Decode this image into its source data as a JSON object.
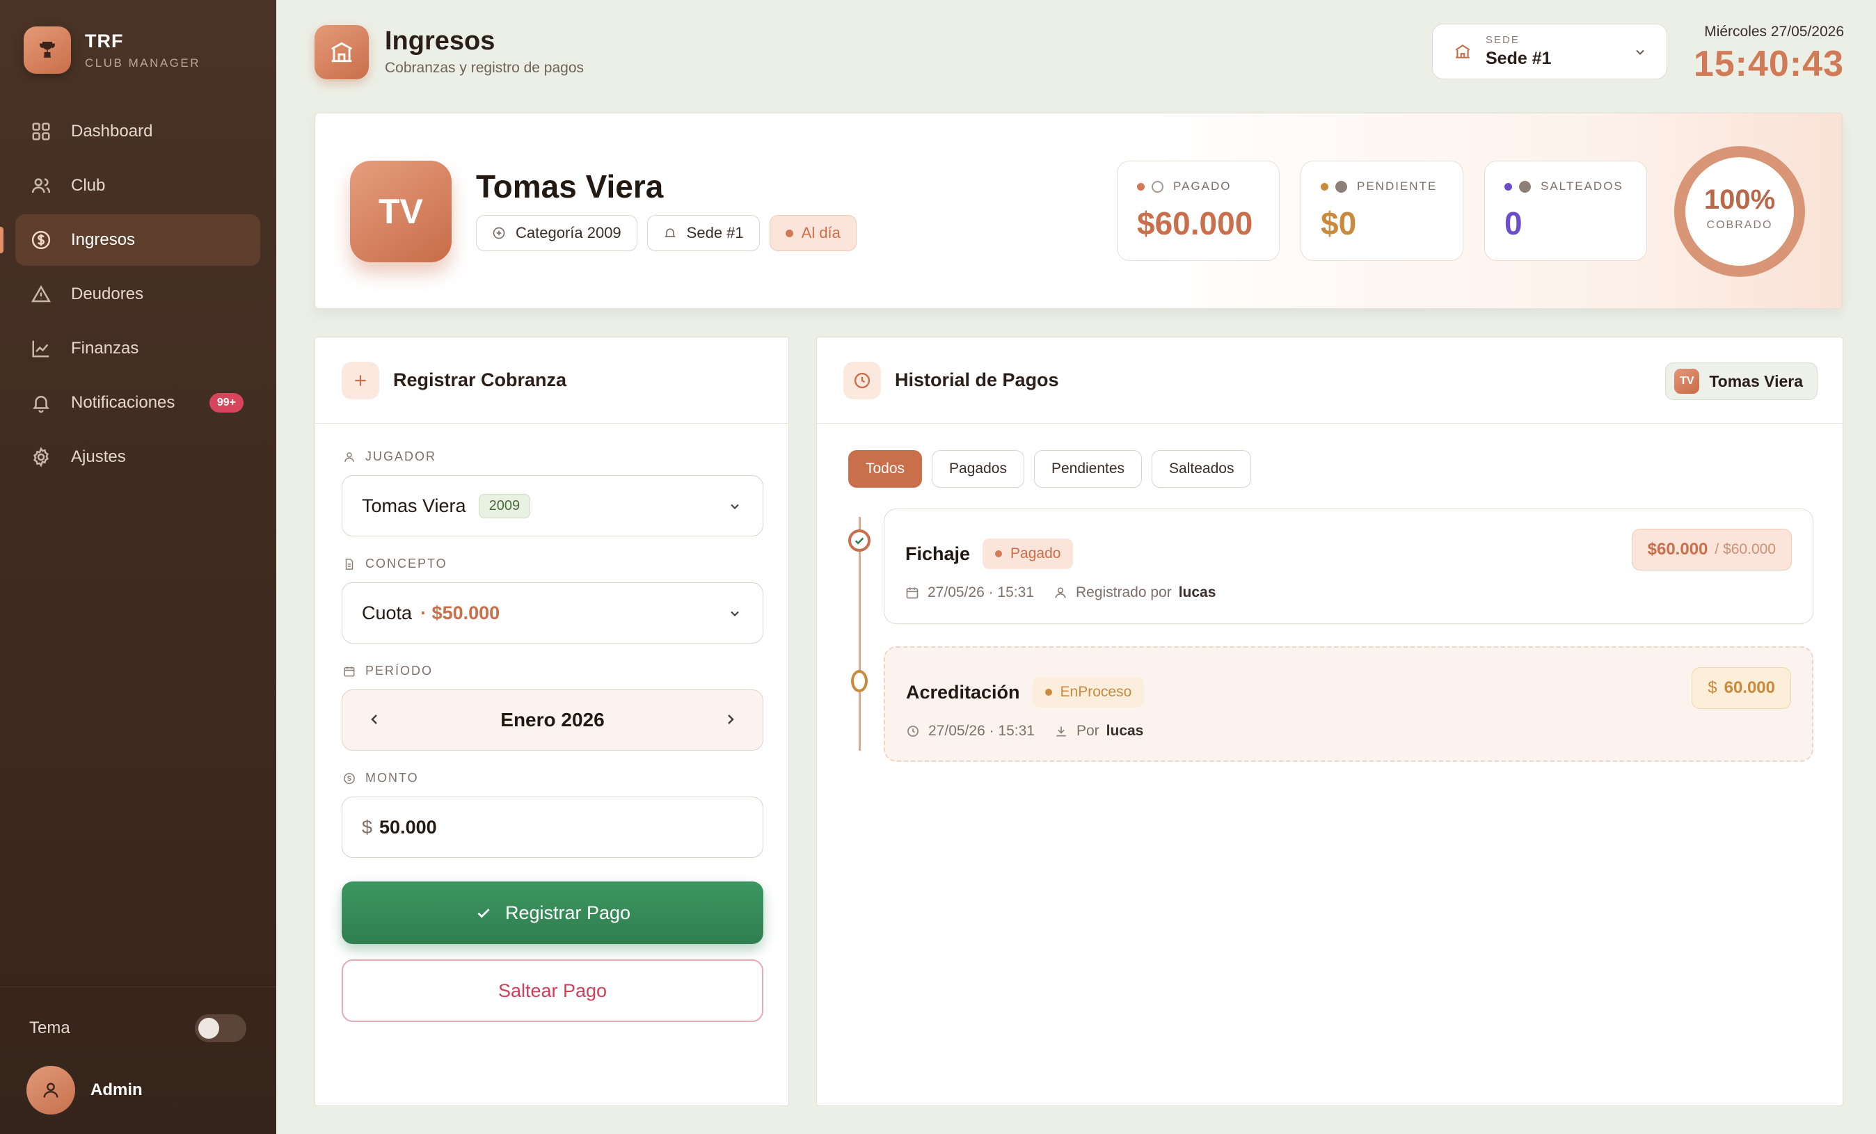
{
  "brand": {
    "title": "TRF",
    "subtitle": "CLUB MANAGER"
  },
  "sidebar": {
    "items": [
      {
        "label": "Dashboard",
        "icon": "grid-icon"
      },
      {
        "label": "Club",
        "icon": "users-icon"
      },
      {
        "label": "Ingresos",
        "icon": "dollar-circle-icon",
        "active": true
      },
      {
        "label": "Deudores",
        "icon": "warning-icon"
      },
      {
        "label": "Finanzas",
        "icon": "chart-line-icon"
      },
      {
        "label": "Notificaciones",
        "icon": "bell-icon",
        "badge": "99+"
      },
      {
        "label": "Ajustes",
        "icon": "gear-icon"
      }
    ],
    "tema_label": "Tema",
    "admin_name": "Admin"
  },
  "header": {
    "title": "Ingresos",
    "subtitle": "Cobranzas y registro de pagos",
    "sede_label": "SEDE",
    "sede_value": "Sede #1",
    "date": "Miércoles 27/05/2026",
    "time": "15:40:43"
  },
  "profile": {
    "initials": "TV",
    "name": "Tomas Viera",
    "category_chip": "Categoría 2009",
    "sede_chip": "Sede #1",
    "status_chip": "Al día",
    "stats": {
      "pagado_label": "PAGADO",
      "pagado_value": "$60.000",
      "pendiente_label": "PENDIENTE",
      "pendiente_value": "$0",
      "salteados_label": "SALTEADOS",
      "salteados_value": "0"
    },
    "cobrado_pct": "100%",
    "cobrado_fraction": 1.0,
    "cobrado_label": "COBRADO"
  },
  "register": {
    "title": "Registrar Cobranza",
    "jugador_label": "JUGADOR",
    "jugador_value": "Tomas Viera",
    "jugador_year": "2009",
    "concepto_label": "CONCEPTO",
    "concepto_value": "Cuota",
    "concepto_price": "· $50.000",
    "periodo_label": "PERÍODO",
    "periodo_value": "Enero 2026",
    "monto_label": "MONTO",
    "monto_currency": "$",
    "monto_value": "50.000",
    "submit_label": "Registrar Pago",
    "skip_label": "Saltear Pago"
  },
  "history": {
    "title": "Historial de Pagos",
    "user_initials": "TV",
    "user_name": "Tomas Viera",
    "tabs": [
      "Todos",
      "Pagados",
      "Pendientes",
      "Salteados"
    ],
    "entries": [
      {
        "title": "Fichaje",
        "badge": "Pagado",
        "date": "27/05/26 · 15:31",
        "by_label": "Registrado por",
        "by_user": "lucas",
        "amount": "$60.000",
        "amount_of": "/ $60.000"
      },
      {
        "title": "Acreditación",
        "badge": "EnProceso",
        "date": "27/05/26 · 15:31",
        "by_label": "Por",
        "by_user": "lucas",
        "amount_currency": "$",
        "amount": "60.000"
      }
    ]
  },
  "colors": {
    "accent": "#c96f4b",
    "success": "#2f7f4f",
    "danger": "#cf3f5a",
    "pending": "#c98a3e",
    "skipped": "#6b4fc8"
  }
}
